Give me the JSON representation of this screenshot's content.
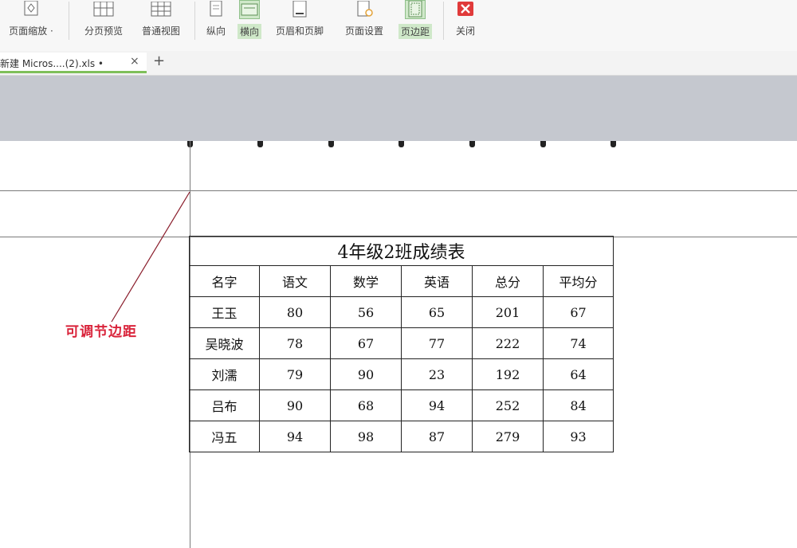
{
  "ribbon": {
    "page_zoom": "页面缩放",
    "zoom_caret": "·",
    "page_break_preview": "分页预览",
    "normal_view": "普通视图",
    "portrait": "纵向",
    "landscape": "横向",
    "header_footer": "页眉和页脚",
    "page_setup": "页面设置",
    "page_margins": "页边距",
    "close": "关闭"
  },
  "tabs": {
    "file_tab": "新建 Micros....(2).xls •",
    "close_glyph": "×",
    "new_tab": "+"
  },
  "annotation": "可调节边距",
  "table": {
    "title": "4年级2班成绩表",
    "headers": [
      "名字",
      "语文",
      "数学",
      "英语",
      "总分",
      "平均分"
    ],
    "rows": [
      [
        "王玉",
        "80",
        "56",
        "65",
        "201",
        "67"
      ],
      [
        "吴晓波",
        "78",
        "67",
        "77",
        "222",
        "74"
      ],
      [
        "刘濡",
        "79",
        "90",
        "23",
        "192",
        "64"
      ],
      [
        "吕布",
        "90",
        "68",
        "94",
        "252",
        "84"
      ],
      [
        "冯五",
        "94",
        "98",
        "87",
        "279",
        "93"
      ]
    ]
  },
  "colors": {
    "accent_green": "#7fbf5a",
    "annotation_red": "#d9233a",
    "close_red": "#e03a3a",
    "band_gray": "#c5c8cf"
  },
  "icons": [
    "page-zoom-icon",
    "page-break-preview-icon",
    "normal-view-icon",
    "portrait-icon",
    "landscape-icon",
    "header-footer-icon",
    "page-setup-icon",
    "page-margins-icon",
    "close-icon"
  ]
}
